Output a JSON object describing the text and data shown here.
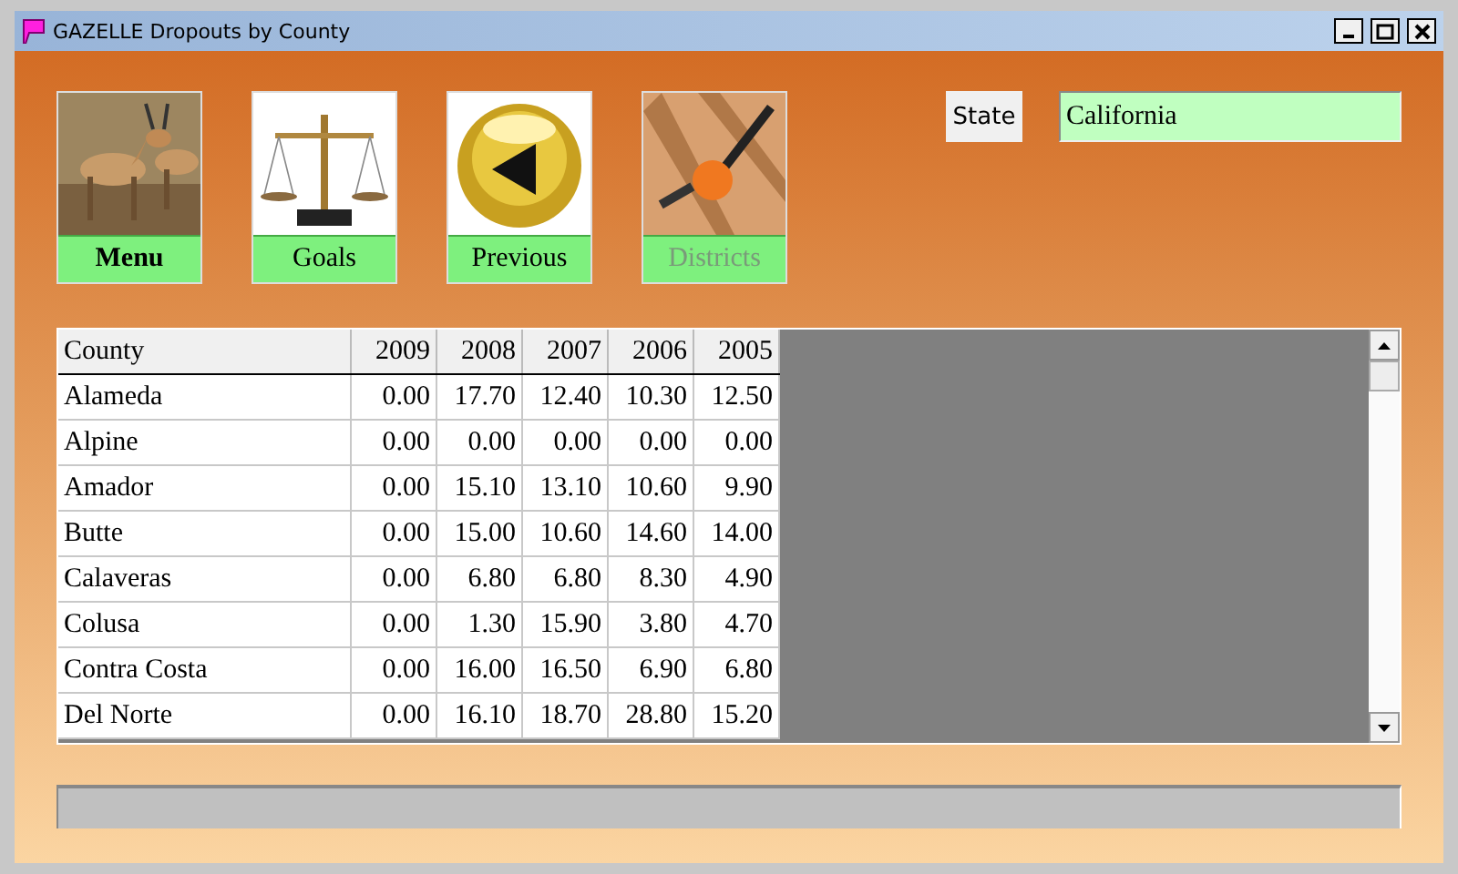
{
  "window": {
    "title": "GAZELLE Dropouts by County"
  },
  "nav_buttons": [
    {
      "label": "Menu",
      "selected": true,
      "disabled": false,
      "kind": "gazelle"
    },
    {
      "label": "Goals",
      "selected": false,
      "disabled": false,
      "kind": "scales"
    },
    {
      "label": "Previous",
      "selected": false,
      "disabled": false,
      "kind": "back"
    },
    {
      "label": "Districts",
      "selected": false,
      "disabled": true,
      "kind": "drill"
    }
  ],
  "state": {
    "label": "State",
    "value": "California"
  },
  "table": {
    "columns": [
      "County",
      "2009",
      "2008",
      "2007",
      "2006",
      "2005"
    ],
    "rows": [
      [
        "Alameda",
        "0.00",
        "17.70",
        "12.40",
        "10.30",
        "12.50"
      ],
      [
        "Alpine",
        "0.00",
        "0.00",
        "0.00",
        "0.00",
        "0.00"
      ],
      [
        "Amador",
        "0.00",
        "15.10",
        "13.10",
        "10.60",
        "9.90"
      ],
      [
        "Butte",
        "0.00",
        "15.00",
        "10.60",
        "14.60",
        "14.00"
      ],
      [
        "Calaveras",
        "0.00",
        "6.80",
        "6.80",
        "8.30",
        "4.90"
      ],
      [
        "Colusa",
        "0.00",
        "1.30",
        "15.90",
        "3.80",
        "4.70"
      ],
      [
        "Contra Costa",
        "0.00",
        "16.00",
        "16.50",
        "6.90",
        "6.80"
      ],
      [
        "Del Norte",
        "0.00",
        "16.10",
        "18.70",
        "28.80",
        "15.20"
      ]
    ]
  }
}
